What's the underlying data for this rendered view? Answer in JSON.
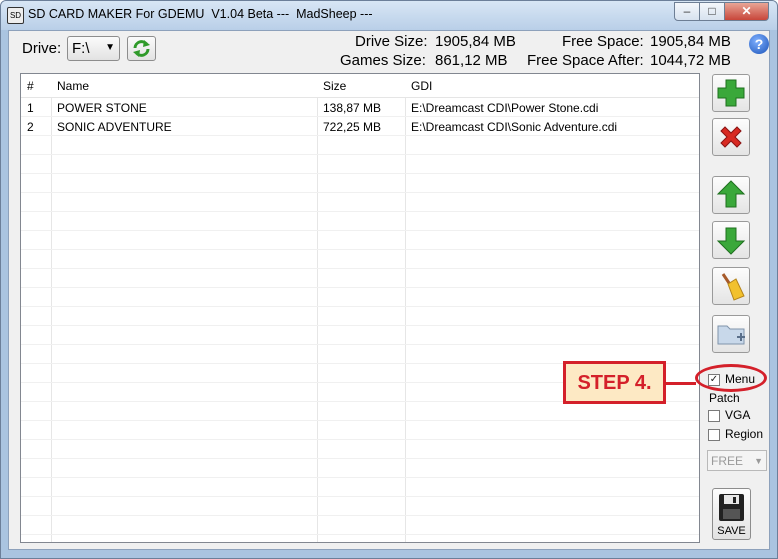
{
  "window": {
    "title": "SD CARD MAKER For GDEMU  V1.04 Beta ---  MadSheep ---",
    "app_icon": "SD",
    "minimize_icon": "minimize-icon",
    "maximize_icon": "maximize-icon",
    "close_icon": "close-icon"
  },
  "toolbar": {
    "drive_label": "Drive:",
    "drive_value": "F:\\",
    "refresh_icon": "refresh-icon",
    "help_glyph": "?"
  },
  "stats": {
    "drive_size_label": "Drive Size:",
    "drive_size_value": "1905,84 MB",
    "games_size_label": "Games Size:",
    "games_size_value": "861,12 MB",
    "free_space_label": "Free Space:",
    "free_space_value": "1905,84 MB",
    "free_after_label": "Free Space After:",
    "free_after_value": "1044,72 MB"
  },
  "table": {
    "columns": [
      "#",
      "Name",
      "Size",
      "GDI"
    ],
    "rows": [
      [
        "1",
        "POWER STONE",
        "138,87 MB",
        "E:\\Dreamcast CDI\\Power Stone.cdi"
      ],
      [
        "2",
        "SONIC ADVENTURE",
        "722,25 MB",
        "E:\\Dreamcast CDI\\Sonic Adventure.cdi"
      ]
    ]
  },
  "side": {
    "add_icon": "add-icon",
    "remove_icon": "remove-icon",
    "move_up_icon": "arrow-up-icon",
    "move_down_icon": "arrow-down-icon",
    "clean_icon": "broom-icon",
    "folder_icon": "new-folder-icon",
    "menu_label": "Menu",
    "menu_checked": true,
    "patch_label": "Patch",
    "vga_label": "VGA",
    "vga_checked": false,
    "region_label": "Region",
    "region_checked": false,
    "region_combo_value": "FREE",
    "save_label": "SAVE",
    "save_icon": "floppy-disk-icon"
  },
  "annotation": {
    "step_text": "STEP 4.",
    "color": "#d4202a"
  }
}
